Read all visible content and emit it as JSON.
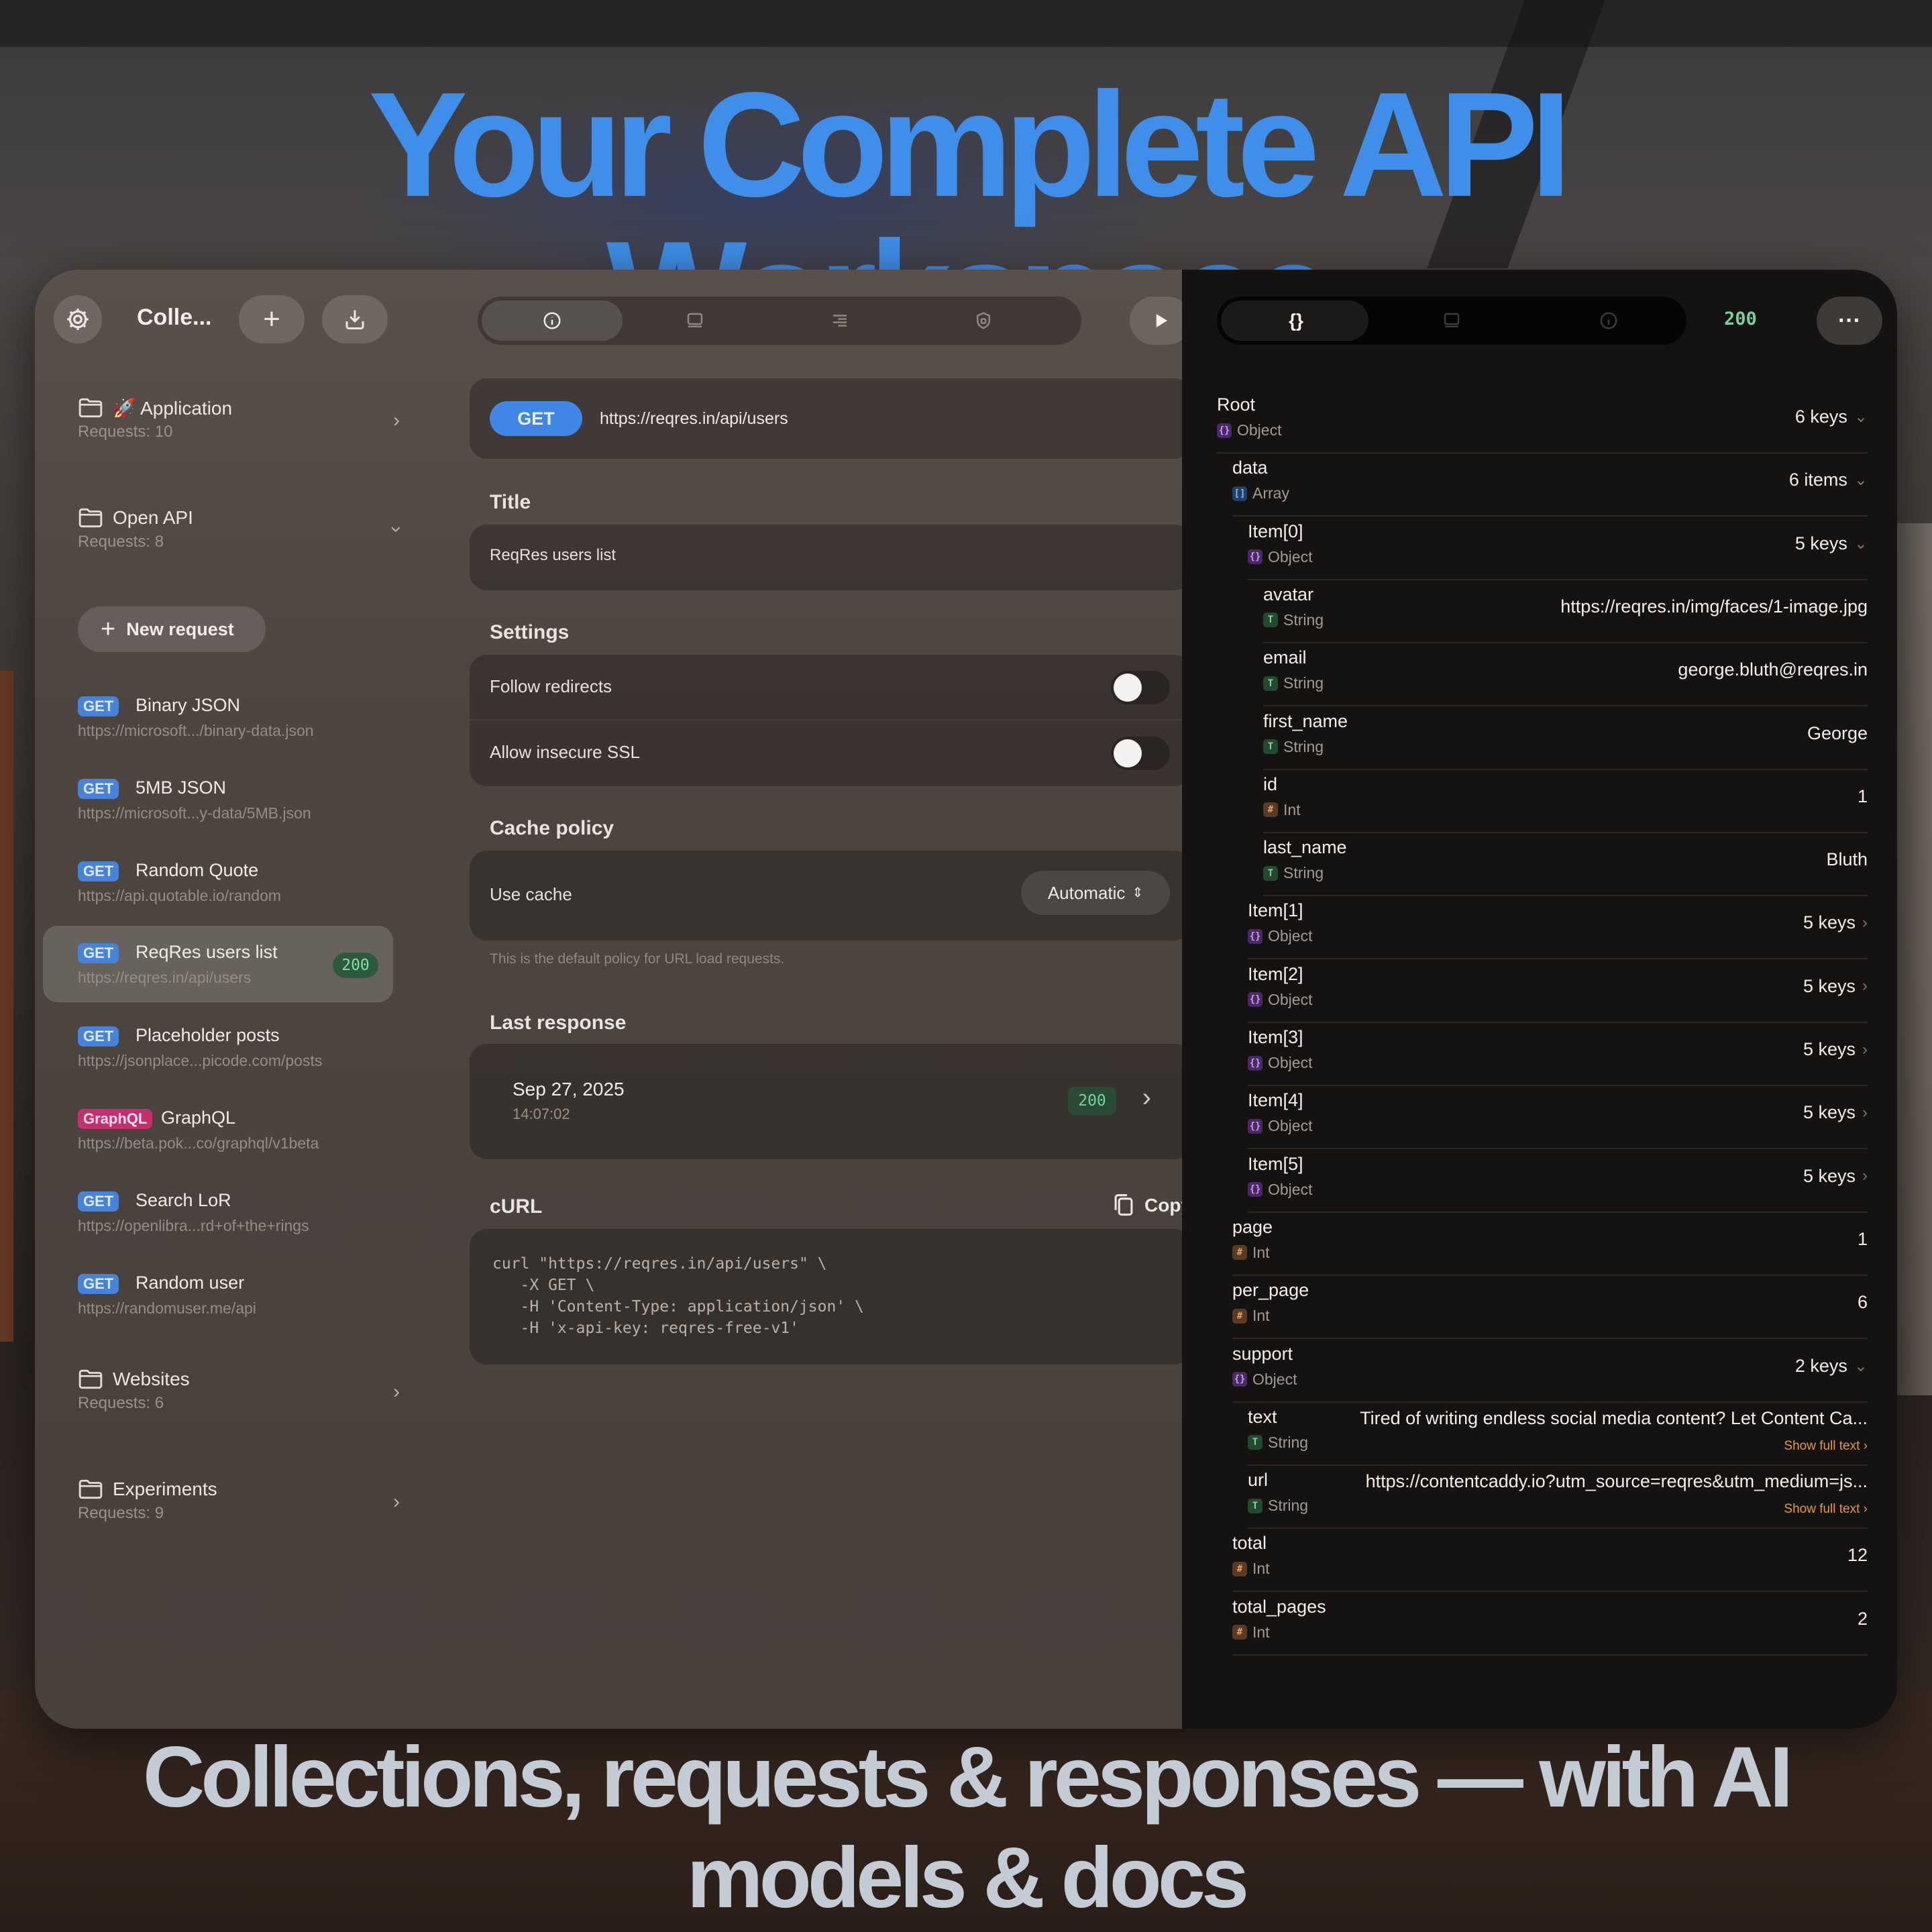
{
  "headline": "Your Complete API Workspace",
  "subline": "Collections, requests & responses — with AI models & docs",
  "sidebar": {
    "title": "Colle...",
    "folders_top": [
      {
        "name": "🚀 Application",
        "requests": "Requests: 10"
      },
      {
        "name": "Open API",
        "requests": "Requests: 8"
      }
    ],
    "new_request_label": "New request",
    "requests": [
      {
        "method": "GET",
        "name": "Binary JSON",
        "url": "https://microsoft.../binary-data.json"
      },
      {
        "method": "GET",
        "name": "5MB JSON",
        "url": "https://microsoft...y-data/5MB.json"
      },
      {
        "method": "GET",
        "name": "Random Quote",
        "url": "https://api.quotable.io/random"
      },
      {
        "method": "GET",
        "name": "ReqRes users list",
        "url": "https://reqres.in/api/users",
        "badge": "200"
      },
      {
        "method": "GET",
        "name": "Placeholder posts",
        "url": "https://jsonplace...picode.com/posts"
      },
      {
        "method": "GraphQL",
        "name": "GraphQL",
        "url": "https://beta.pok...co/graphql/v1beta"
      },
      {
        "method": "GET",
        "name": "Search LoR",
        "url": "https://openlibra...rd+of+the+rings"
      },
      {
        "method": "GET",
        "name": "Random user",
        "url": "https://randomuser.me/api"
      }
    ],
    "folders_bottom": [
      {
        "name": "Websites",
        "requests": "Requests: 6"
      },
      {
        "name": "Experiments",
        "requests": "Requests: 9"
      }
    ]
  },
  "request": {
    "method": "GET",
    "url": "https://reqres.in/api/users",
    "title_label": "Title",
    "title_value": "ReqRes users list",
    "settings_label": "Settings",
    "follow_redirects": "Follow redirects",
    "allow_insecure_ssl": "Allow insecure SSL",
    "cache_policy_label": "Cache policy",
    "use_cache": "Use cache",
    "cache_value": "Automatic",
    "cache_hint": "This is the default policy for URL load requests.",
    "last_response_label": "Last response",
    "last_response_date": "Sep 27, 2025",
    "last_response_time": "14:07:02",
    "last_response_status": "200",
    "curl_label": "cURL",
    "copy_label": "Copy",
    "curl_code": "curl \"https://reqres.in/api/users\" \\\n   -X GET \\\n   -H 'Content-Type: application/json' \\\n   -H 'x-api-key: reqres-free-v1'"
  },
  "response": {
    "tab_json_icon": "{}",
    "status": "200",
    "more_label": "···",
    "show_full_text": "Show full text ›",
    "nodes": [
      {
        "key": "Root",
        "type": "Object",
        "kind": "obj",
        "meta": "6 keys",
        "arrow": "down",
        "indent": 0
      },
      {
        "key": "data",
        "type": "Array",
        "kind": "arr",
        "meta": "6 items",
        "arrow": "down",
        "indent": 1
      },
      {
        "key": "Item[0]",
        "type": "Object",
        "kind": "obj",
        "meta": "5 keys",
        "arrow": "down",
        "indent": 2
      },
      {
        "key": "avatar",
        "type": "String",
        "kind": "str",
        "value": "https://reqres.in/img/faces/1-image.jpg",
        "indent": 3
      },
      {
        "key": "email",
        "type": "String",
        "kind": "str",
        "value": "george.bluth@reqres.in",
        "indent": 3
      },
      {
        "key": "first_name",
        "type": "String",
        "kind": "str",
        "value": "George",
        "indent": 3
      },
      {
        "key": "id",
        "type": "Int",
        "kind": "int",
        "value": "1",
        "indent": 3
      },
      {
        "key": "last_name",
        "type": "String",
        "kind": "str",
        "value": "Bluth",
        "indent": 3
      },
      {
        "key": "Item[1]",
        "type": "Object",
        "kind": "obj",
        "meta": "5 keys",
        "arrow": "right",
        "indent": 2
      },
      {
        "key": "Item[2]",
        "type": "Object",
        "kind": "obj",
        "meta": "5 keys",
        "arrow": "right",
        "indent": 2
      },
      {
        "key": "Item[3]",
        "type": "Object",
        "kind": "obj",
        "meta": "5 keys",
        "arrow": "right",
        "indent": 2
      },
      {
        "key": "Item[4]",
        "type": "Object",
        "kind": "obj",
        "meta": "5 keys",
        "arrow": "right",
        "indent": 2
      },
      {
        "key": "Item[5]",
        "type": "Object",
        "kind": "obj",
        "meta": "5 keys",
        "arrow": "right",
        "indent": 2
      },
      {
        "key": "page",
        "type": "Int",
        "kind": "int",
        "value": "1",
        "indent": 1
      },
      {
        "key": "per_page",
        "type": "Int",
        "kind": "int",
        "value": "6",
        "indent": 1
      },
      {
        "key": "support",
        "type": "Object",
        "kind": "obj",
        "meta": "2 keys",
        "arrow": "down",
        "indent": 1
      },
      {
        "key": "text",
        "type": "String",
        "kind": "str",
        "long": true,
        "value": "Tired of writing endless social media content? Let Content Ca...",
        "indent": 2
      },
      {
        "key": "url",
        "type": "String",
        "kind": "str",
        "long": true,
        "value": "https://contentcaddy.io?utm_source=reqres&utm_medium=js...",
        "indent": 2
      },
      {
        "key": "total",
        "type": "Int",
        "kind": "int",
        "value": "12",
        "indent": 1
      },
      {
        "key": "total_pages",
        "type": "Int",
        "kind": "int",
        "value": "2",
        "indent": 1
      }
    ]
  }
}
